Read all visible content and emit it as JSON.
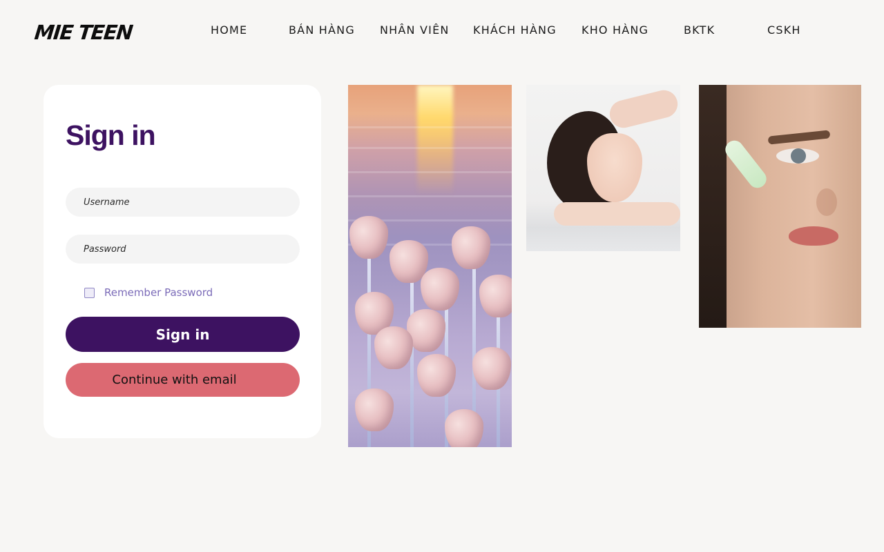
{
  "header": {
    "logo": "MIE TEEN",
    "nav": [
      {
        "label": "HOME"
      },
      {
        "label": "BÁN HÀNG"
      },
      {
        "label": "NHÂN VIÊN"
      },
      {
        "label": "KHÁCH HÀNG"
      },
      {
        "label": "KHO HÀNG"
      },
      {
        "label": "BKTK"
      },
      {
        "label": "CSKH"
      }
    ]
  },
  "signin": {
    "title": "Sign in",
    "username_placeholder": "Username",
    "username_value": "",
    "password_placeholder": "Password",
    "password_value": "",
    "remember_label": "Remember Password",
    "remember_checked": false,
    "signin_button": "Sign in",
    "email_button": "Continue with email"
  },
  "colors": {
    "primary": "#3d1261",
    "accent": "#dc6972",
    "background": "#f7f6f4",
    "remember_text": "#7b6bb8"
  },
  "gallery": [
    {
      "name": "tulips-photo"
    },
    {
      "name": "woman-portrait-photo"
    },
    {
      "name": "skincare-face-photo"
    }
  ]
}
